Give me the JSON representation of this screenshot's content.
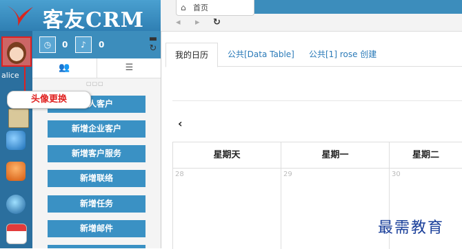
{
  "header": {
    "logo_text": "客友CRM"
  },
  "tabbar": {
    "home_tab": "首页",
    "home_icon": "home-icon"
  },
  "sidebar": {
    "user_name": "alice",
    "icons": [
      "contacts-icon",
      "person-icon",
      "globe-icon",
      "calendar-icon"
    ]
  },
  "panel": {
    "counters": [
      {
        "icon": "clock-icon",
        "value": "0"
      },
      {
        "icon": "bell-icon",
        "value": "0"
      }
    ],
    "actions": [
      "个人客户",
      "新增企业客户",
      "新增客户服务",
      "新增联络",
      "新增任务",
      "新增邮件"
    ]
  },
  "callout": {
    "text": "头像更换"
  },
  "main": {
    "tabs": [
      "我的日历",
      "公共[Data Table]",
      "公共[1] rose 创建"
    ],
    "calendar": {
      "days": [
        "星期天",
        "星期一",
        "星期二"
      ],
      "dates": [
        "28",
        "29",
        "30"
      ]
    }
  },
  "watermark": "最需教育",
  "colors": {
    "header_blue": "#3c8dbc",
    "button_blue": "#3a91c4",
    "callout_red": "#e0201f"
  }
}
